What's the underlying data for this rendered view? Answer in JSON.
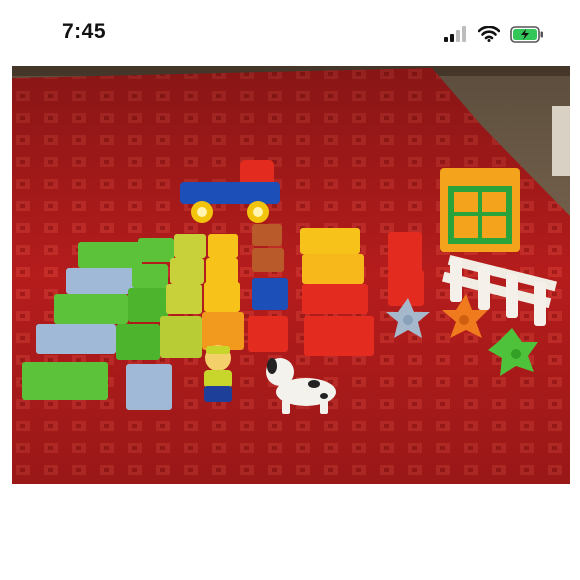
{
  "status_bar": {
    "time": "7:45",
    "icons": [
      "cellular-signal-icon",
      "wifi-icon",
      "battery-charging-icon"
    ],
    "battery_color": "#33c759"
  },
  "photo": {
    "subject": "toy-blocks-on-red-rug",
    "colors": {
      "rug": "#b01a1a",
      "floor": "#7a6650"
    }
  }
}
